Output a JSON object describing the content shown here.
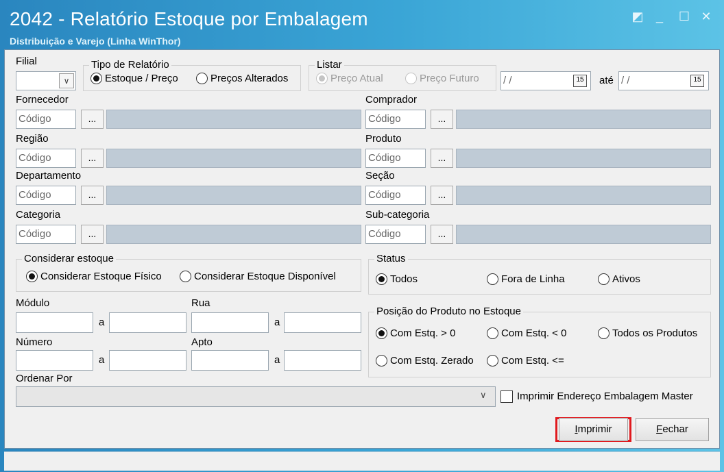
{
  "window": {
    "title": "2042 - Relatório Estoque por Embalagem",
    "subtitle": "Distribuição e Varejo (Linha WinThor)"
  },
  "filial": {
    "label": "Filial"
  },
  "tipo_relatorio": {
    "title": "Tipo de Relatório",
    "options": [
      "Estoque / Preço",
      "Preços Alterados"
    ],
    "selected": "Estoque / Preço"
  },
  "listar": {
    "title": "Listar",
    "options": [
      "Preço Atual",
      "Preço Futuro"
    ],
    "selected": "Preço Atual",
    "date_from": "/ /",
    "date_sep": "até",
    "date_to": "/ /",
    "calendar_icon_text": "15"
  },
  "filters": {
    "placeholder": "Código",
    "dots": "...",
    "left": [
      "Fornecedor",
      "Região",
      "Departamento",
      "Categoria"
    ],
    "right": [
      "Comprador",
      "Produto",
      "Seção",
      "Sub-categoria"
    ]
  },
  "considerar_estoque": {
    "title": "Considerar estoque",
    "options": [
      "Considerar Estoque Físico",
      "Considerar Estoque Disponível"
    ],
    "selected": "Considerar Estoque Físico"
  },
  "status": {
    "title": "Status",
    "options": [
      "Todos",
      "Fora de Linha",
      "Ativos"
    ],
    "selected": "Todos"
  },
  "localizacao": {
    "modulo": "Módulo",
    "rua": "Rua",
    "numero": "Número",
    "apto": "Apto",
    "sep": "a"
  },
  "posicao": {
    "title": "Posição do Produto no Estoque",
    "options": [
      "Com Estq. > 0",
      "Com Estq. < 0",
      "Todos os Produtos",
      "Com Estq. Zerado",
      "Com Estq. <="
    ],
    "selected": "Com Estq. > 0"
  },
  "ordenar": {
    "label": "Ordenar Por",
    "value": ""
  },
  "imprimir_master": {
    "label": "Imprimir Endereço Embalagem Master",
    "checked": false
  },
  "buttons": {
    "imprimir_hotkey": "I",
    "imprimir_rest": "mprimir",
    "fechar_hotkey": "F",
    "fechar_rest": "echar"
  },
  "colors": {
    "highlight": "#e0191e",
    "title_bar": "#2a86bf"
  }
}
